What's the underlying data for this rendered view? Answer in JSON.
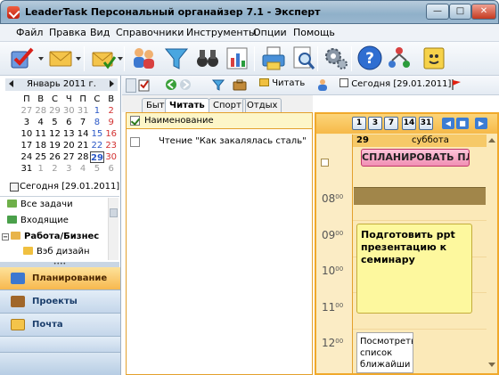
{
  "window": {
    "title": "LeaderTask Персональный органайзер 7.1 - Эксперт",
    "min": "—",
    "max": "□",
    "close": "✕"
  },
  "menu": [
    "Файл",
    "Правка",
    "Вид",
    "Справочники",
    "Инструменты",
    "Опции",
    "Помощь"
  ],
  "toolbar": {
    "icons": [
      "check-list-icon",
      "envelope-icon",
      "envelope-check-icon",
      "people-icon",
      "filter-icon",
      "binoculars-icon",
      "chart-icon",
      "printer-icon",
      "magnifier-icon",
      "gears-icon",
      "help-icon",
      "network-icon",
      "notepad-icon"
    ]
  },
  "calendar": {
    "month": "Январь 2011 г.",
    "dow": [
      "П",
      "В",
      "С",
      "Ч",
      "П",
      "С",
      "В"
    ],
    "weeks": [
      [
        "27",
        "28",
        "29",
        "30",
        "31",
        "1",
        "2"
      ],
      [
        "3",
        "4",
        "5",
        "6",
        "7",
        "8",
        "9"
      ],
      [
        "10",
        "11",
        "12",
        "13",
        "14",
        "15",
        "16"
      ],
      [
        "17",
        "18",
        "19",
        "20",
        "21",
        "22",
        "23"
      ],
      [
        "24",
        "25",
        "26",
        "27",
        "28",
        "29",
        "30"
      ],
      [
        "31",
        "1",
        "2",
        "3",
        "4",
        "5",
        "6"
      ]
    ],
    "today": "Сегодня [29.01.2011]"
  },
  "folders": [
    {
      "label": "Все задачи",
      "color": "#6fb04a"
    },
    {
      "label": "Входящие",
      "color": "#4aa04a"
    },
    {
      "label": "Работа/Бизнес",
      "color": "#e8b44a"
    },
    {
      "label": "Вэб дизайн",
      "color": "#f0c040"
    }
  ],
  "nav": [
    {
      "label": "Планирование"
    },
    {
      "label": "Проекты"
    },
    {
      "label": "Почта"
    }
  ],
  "toolbar2": {
    "read_label": "Читать",
    "today_label": "Сегодня [29.01.2011]"
  },
  "tabs": [
    "Быт",
    "Читать",
    "Спорт",
    "Отдых"
  ],
  "tasks": {
    "header": "Наименование",
    "rows": [
      {
        "text": "Чтение \"Как закалялась сталь\""
      }
    ]
  },
  "dayview": {
    "view_buttons": [
      "1",
      "3",
      "7",
      "14",
      "31"
    ],
    "day_num": "29",
    "day_name": "суббота",
    "plan_button": "СПЛАНИРОВАТЬ ПЛ",
    "hours": [
      "08",
      "09",
      "10",
      "11",
      "12"
    ],
    "minutes": "00",
    "event1": "Подготовить ppt презентацию к семинару",
    "event2": "Посмотреть список ближайши"
  },
  "colors": {
    "accent": "#f0a92c",
    "nav_active": "#f7b84e",
    "event": "#fdf89e",
    "plan_button": "#f18fb4"
  }
}
